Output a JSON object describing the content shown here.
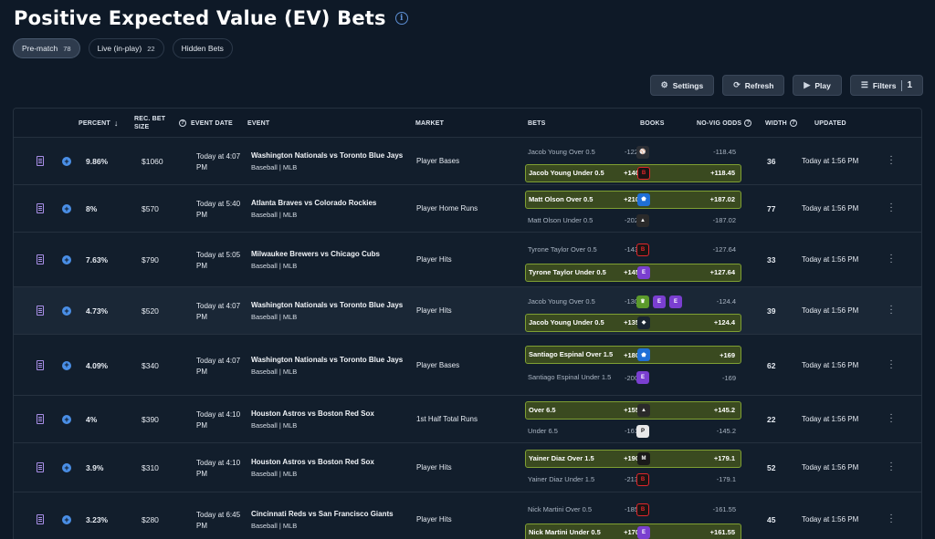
{
  "title": "Positive Expected Value (EV) Bets",
  "tabs": [
    {
      "label": "Pre-match",
      "count": "78"
    },
    {
      "label": "Live (in-play)",
      "count": "22"
    },
    {
      "label": "Hidden Bets",
      "count": ""
    }
  ],
  "toolbar": {
    "settings": "Settings",
    "refresh": "Refresh",
    "play": "Play",
    "filters": "Filters",
    "filters_count": "1"
  },
  "columns": {
    "percent": "PERCENT",
    "rec_bet_size_1": "REC. BET",
    "rec_bet_size_2": "SIZE",
    "event_date": "EVENT DATE",
    "event": "EVENT",
    "market": "MARKET",
    "bets": "BETS",
    "books": "BOOKS",
    "no_vig_odds": "NO-VIG ODDS",
    "width": "WIDTH",
    "updated": "UPDATED"
  },
  "book_colors": {
    "fanatics-book": "#2a2e35",
    "betrivers-book": "#1a1414",
    "fanduel-book": "#1f6fd6",
    "caesars-book": "#1a2530",
    "draftkings-book": "#5c9a2c",
    "espnbet-book": "#7a3fd0",
    "betmgm-book": "#1a1a1a",
    "pointsbet-book": "#e8e8e8",
    "hardrock-book": "#2a2a2a"
  },
  "rows": [
    {
      "percent": "9.86%",
      "size": "$1060",
      "date": "Today at 4:07 PM",
      "event": "Washington Nationals vs Toronto Blue Jays",
      "league": "Baseball | MLB",
      "market": "Player Bases",
      "width": "36",
      "updated": "Today at 1:56 PM",
      "bets": [
        {
          "label": "Jacob Young Over 0.5",
          "odds": "-122",
          "books": [
            "fanatics-book"
          ],
          "nv": "-118.45",
          "best": false
        },
        {
          "label": "Jacob Young Under 0.5",
          "odds": "+140",
          "books": [
            "betrivers-book"
          ],
          "nv": "+118.45",
          "best": true
        }
      ]
    },
    {
      "percent": "8%",
      "size": "$570",
      "date": "Today at 5:40 PM",
      "event": "Atlanta Braves vs Colorado Rockies",
      "league": "Baseball | MLB",
      "market": "Player Home Runs",
      "width": "77",
      "updated": "Today at 1:56 PM",
      "bets": [
        {
          "label": "Matt Olson Over 0.5",
          "odds": "+210",
          "books": [
            "fanduel-book"
          ],
          "nv": "+187.02",
          "best": true
        },
        {
          "label": "Matt Olson Under 0.5",
          "odds": "-202",
          "books": [
            "hardrock-book"
          ],
          "nv": "-187.02",
          "best": false
        }
      ]
    },
    {
      "percent": "7.63%",
      "size": "$790",
      "date": "Today at 5:05 PM",
      "event": "Milwaukee Brewers vs Chicago Cubs",
      "league": "Baseball | MLB",
      "market": "Player Hits",
      "width": "33",
      "updated": "Today at 1:56 PM",
      "bets": [
        {
          "label": "Tyrone Taylor Over 0.5",
          "odds": "-143",
          "books": [
            "betrivers-book"
          ],
          "nv": "-127.64",
          "best": false
        },
        {
          "label": "Tyrone Taylor Under 0.5",
          "odds": "+145",
          "books": [
            "espnbet-book"
          ],
          "nv": "+127.64",
          "best": true
        }
      ]
    },
    {
      "percent": "4.73%",
      "size": "$520",
      "date": "Today at 4:07 PM",
      "event": "Washington Nationals vs Toronto Blue Jays",
      "league": "Baseball | MLB",
      "market": "Player Hits",
      "width": "39",
      "updated": "Today at 1:56 PM",
      "bets": [
        {
          "label": "Jacob Young Over 0.5",
          "odds": "-130",
          "books": [
            "draftkings-book",
            "espnbet-book",
            "espnbet-book"
          ],
          "nv": "-124.4",
          "best": false
        },
        {
          "label": "Jacob Young Under 0.5",
          "odds": "+135",
          "books": [
            "caesars-book"
          ],
          "nv": "+124.4",
          "best": true
        }
      ]
    },
    {
      "percent": "4.09%",
      "size": "$340",
      "date": "Today at 4:07 PM",
      "event": "Washington Nationals vs Toronto Blue Jays",
      "league": "Baseball | MLB",
      "market": "Player Bases",
      "width": "62",
      "updated": "Today at 1:56 PM",
      "bets": [
        {
          "label": "Santiago Espinal Over 1.5",
          "odds": "+180",
          "books": [
            "fanduel-book"
          ],
          "nv": "+169",
          "best": true
        },
        {
          "label": "Santiago Espinal Under 1.5",
          "odds": "-200",
          "books": [
            "espnbet-book"
          ],
          "nv": "-169",
          "best": false
        }
      ]
    },
    {
      "percent": "4%",
      "size": "$390",
      "date": "Today at 4:10 PM",
      "event": "Houston Astros vs Boston Red Sox",
      "league": "Baseball | MLB",
      "market": "1st Half Total Runs",
      "width": "22",
      "updated": "Today at 1:56 PM",
      "bets": [
        {
          "label": "Over 6.5",
          "odds": "+155",
          "books": [
            "hardrock-book"
          ],
          "nv": "+145.2",
          "best": true
        },
        {
          "label": "Under 6.5",
          "odds": "-161",
          "books": [
            "pointsbet-book"
          ],
          "nv": "-145.2",
          "best": false
        }
      ]
    },
    {
      "percent": "3.9%",
      "size": "$310",
      "date": "Today at 4:10 PM",
      "event": "Houston Astros vs Boston Red Sox",
      "league": "Baseball | MLB",
      "market": "Player Hits",
      "width": "52",
      "updated": "Today at 1:56 PM",
      "bets": [
        {
          "label": "Yainer Diaz Over 1.5",
          "odds": "+190",
          "books": [
            "betmgm-book"
          ],
          "nv": "+179.1",
          "best": true
        },
        {
          "label": "Yainer Diaz Under 1.5",
          "odds": "-213",
          "books": [
            "betrivers-book"
          ],
          "nv": "-179.1",
          "best": false
        }
      ]
    },
    {
      "percent": "3.23%",
      "size": "$280",
      "date": "Today at 6:45 PM",
      "event": "Cincinnati Reds vs San Francisco Giants",
      "league": "Baseball | MLB",
      "market": "Player Hits",
      "width": "45",
      "updated": "Today at 1:56 PM",
      "bets": [
        {
          "label": "Nick Martini Over 0.5",
          "odds": "-185",
          "books": [
            "betrivers-book"
          ],
          "nv": "-161.55",
          "best": false
        },
        {
          "label": "Nick Martini Under 0.5",
          "odds": "+170",
          "books": [
            "espnbet-book"
          ],
          "nv": "+161.55",
          "best": true
        }
      ]
    }
  ]
}
